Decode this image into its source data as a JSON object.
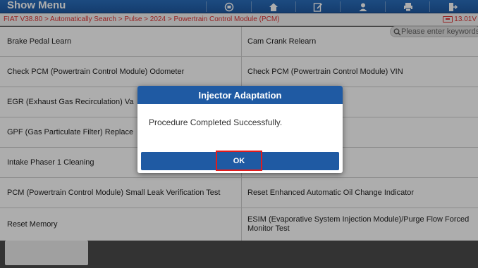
{
  "header": {
    "title": "Show Menu",
    "buttons": [
      {
        "name": "engine-icon"
      },
      {
        "name": "home-icon"
      },
      {
        "name": "edit-icon"
      },
      {
        "name": "user-icon"
      },
      {
        "name": "print-icon"
      },
      {
        "name": "exit-icon"
      }
    ]
  },
  "breadcrumb": "FIAT V38.80 > Automatically Search > Pulse > 2024 > Powertrain Control Module (PCM)",
  "voltage": "13.01V",
  "search": {
    "placeholder": "Please enter keywords"
  },
  "rows": [
    {
      "left": "Brake Pedal Learn",
      "right": "Cam Crank Relearn"
    },
    {
      "left": "Check PCM (Powertrain Control Module) Odometer",
      "right": "Check PCM (Powertrain Control Module) VIN"
    },
    {
      "left": "EGR (Exhaust Gas Recirculation) Va",
      "right": "g"
    },
    {
      "left": "GPF (Gas Particulate Filter) Replace",
      "right": ""
    },
    {
      "left": "Intake Phaser 1 Cleaning",
      "right": "ottle Control) (NGC4)"
    },
    {
      "left": "PCM (Powertrain Control Module) Small Leak Verification Test",
      "right": "Reset Enhanced Automatic Oil Change Indicator"
    },
    {
      "left": "Reset Memory",
      "right": "ESIM (Evaporative System Injection Module)/Purge Flow Forced Monitor Test"
    }
  ],
  "dialog": {
    "title": "Injector Adaptation",
    "message": "Procedure Completed Successfully.",
    "ok_label": "OK"
  },
  "colors": {
    "accent": "#1f5aa3",
    "highlight": "#e21b1b",
    "crumb": "#dd3333"
  }
}
